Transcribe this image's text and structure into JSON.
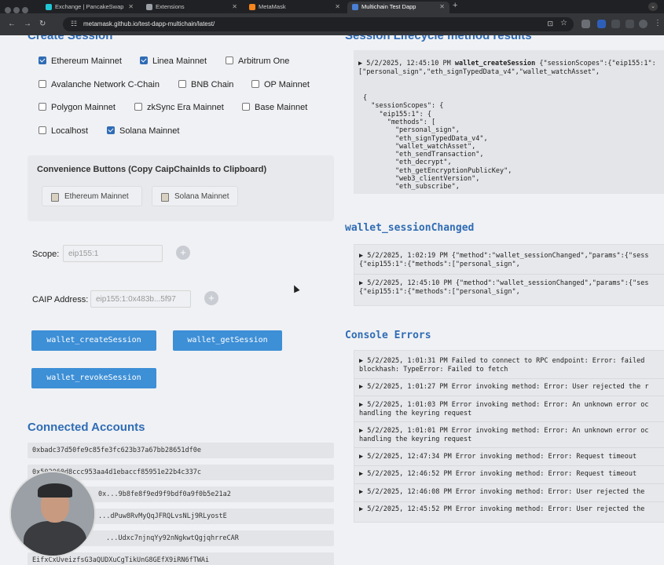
{
  "browser": {
    "tabs": [
      {
        "label": "Exchange | PancakeSwap",
        "color": "#1fc7d4"
      },
      {
        "label": "Extensions",
        "color": "#9aa0a6"
      },
      {
        "label": "MetaMask",
        "color": "#f6851b"
      },
      {
        "label": "Multichain Test Dapp",
        "color": "#4a7fd6"
      }
    ],
    "new_tab": "+",
    "tab_menu": "⌄",
    "url": "metamask.github.io/test-dapp-multichain/latest/"
  },
  "create_session": {
    "title": "Create Session",
    "networks": [
      {
        "label": "Ethereum Mainnet",
        "checked": true
      },
      {
        "label": "Linea Mainnet",
        "checked": true
      },
      {
        "label": "Arbitrum One",
        "checked": false
      },
      {
        "label": "Avalanche Network C-Chain",
        "checked": false
      },
      {
        "label": "BNB Chain",
        "checked": false
      },
      {
        "label": "OP Mainnet",
        "checked": false
      },
      {
        "label": "Polygon Mainnet",
        "checked": false
      },
      {
        "label": "zkSync Era Mainnet",
        "checked": false
      },
      {
        "label": "Base Mainnet",
        "checked": false
      },
      {
        "label": "Localhost",
        "checked": false
      },
      {
        "label": "Solana Mainnet",
        "checked": true
      }
    ]
  },
  "convenience": {
    "title": "Convenience Buttons (Copy CaipChainIds to Clipboard)",
    "buttons": [
      "Ethereum Mainnet",
      "Solana Mainnet"
    ]
  },
  "scope": {
    "label": "Scope:",
    "value": "eip155:1"
  },
  "caip": {
    "label": "CAIP Address:",
    "value": "eip155:1:0x483b...5f97"
  },
  "actions": {
    "create": "wallet_createSession",
    "get": "wallet_getSession",
    "revoke": "wallet_revokeSession"
  },
  "connected": {
    "title": "Connected Accounts",
    "accounts": [
      "0xbadc37d50fe9c85fe3fc623b37a67bb28651df0e",
      "0x502060d8ccc953aa4d1ebaccf85951e22b4c337c",
      "0x...9b8fe8f9ed9f9bdf0a9f0b5e21a2",
      "...dPuw8RvMyQqJFRQLvsNLj9RLyostE",
      "...Udxc7njnqYy92nNgkwtQgjqhrreCAR",
      "EifxCxUveizfsG3aQUDXuCgTikUnG8GEfX9iRN6fTWAi"
    ]
  },
  "lifecycle": {
    "title": "Session Lifecycle method results",
    "header_ts": "5/2/2025, 12:45:10 PM",
    "header_method": "wallet_createSession",
    "header_tail": "{\"sessionScopes\":{\"eip155:1\":",
    "header_line2": "[\"personal_sign\",\"eth_signTypedData_v4\",\"wallet_watchAsset\",",
    "json_lines": [
      "{",
      "  \"sessionScopes\": {",
      "    \"eip155:1\": {",
      "      \"methods\": [",
      "        \"personal_sign\",",
      "        \"eth_signTypedData_v4\",",
      "        \"wallet_watchAsset\",",
      "        \"eth_sendTransaction\",",
      "        \"eth_decrypt\",",
      "        \"eth_getEncryptionPublicKey\",",
      "        \"web3_clientVersion\",",
      "        \"eth_subscribe\","
    ]
  },
  "session_changed": {
    "title": "wallet_sessionChanged",
    "entries": [
      {
        "line1": "▶ 5/2/2025, 1:02:19 PM  {\"method\":\"wallet_sessionChanged\",\"params\":{\"sess",
        "line2": "{\"eip155:1\":{\"methods\":[\"personal_sign\","
      },
      {
        "line1": "▶ 5/2/2025, 12:45:10 PM  {\"method\":\"wallet_sessionChanged\",\"params\":{\"ses",
        "line2": "{\"eip155:1\":{\"methods\":[\"personal_sign\","
      }
    ]
  },
  "console": {
    "title": "Console Errors",
    "entries": [
      {
        "line1": "▶ 5/2/2025, 1:01:31 PM  Failed to connect to RPC endpoint: Error: failed",
        "line2": "blockhash: TypeError: Failed to fetch"
      },
      {
        "line1": "▶ 5/2/2025, 1:01:27 PM  Error invoking method: Error: User rejected the r",
        "line2": ""
      },
      {
        "line1": "▶ 5/2/2025, 1:01:03 PM  Error invoking method: Error: An unknown error oc",
        "line2": "handling the keyring request"
      },
      {
        "line1": "▶ 5/2/2025, 1:01:01 PM  Error invoking method: Error: An unknown error oc",
        "line2": "handling the keyring request"
      },
      {
        "line1": "▶ 5/2/2025, 12:47:34 PM  Error invoking method: Error: Request timeout",
        "line2": ""
      },
      {
        "line1": "▶ 5/2/2025, 12:46:52 PM  Error invoking method: Error: Request timeout",
        "line2": ""
      },
      {
        "line1": "▶ 5/2/2025, 12:46:08 PM  Error invoking method: Error: User rejected the",
        "line2": ""
      },
      {
        "line1": "▶ 5/2/2025, 12:45:52 PM  Error invoking method: Error: User rejected the",
        "line2": ""
      }
    ]
  }
}
